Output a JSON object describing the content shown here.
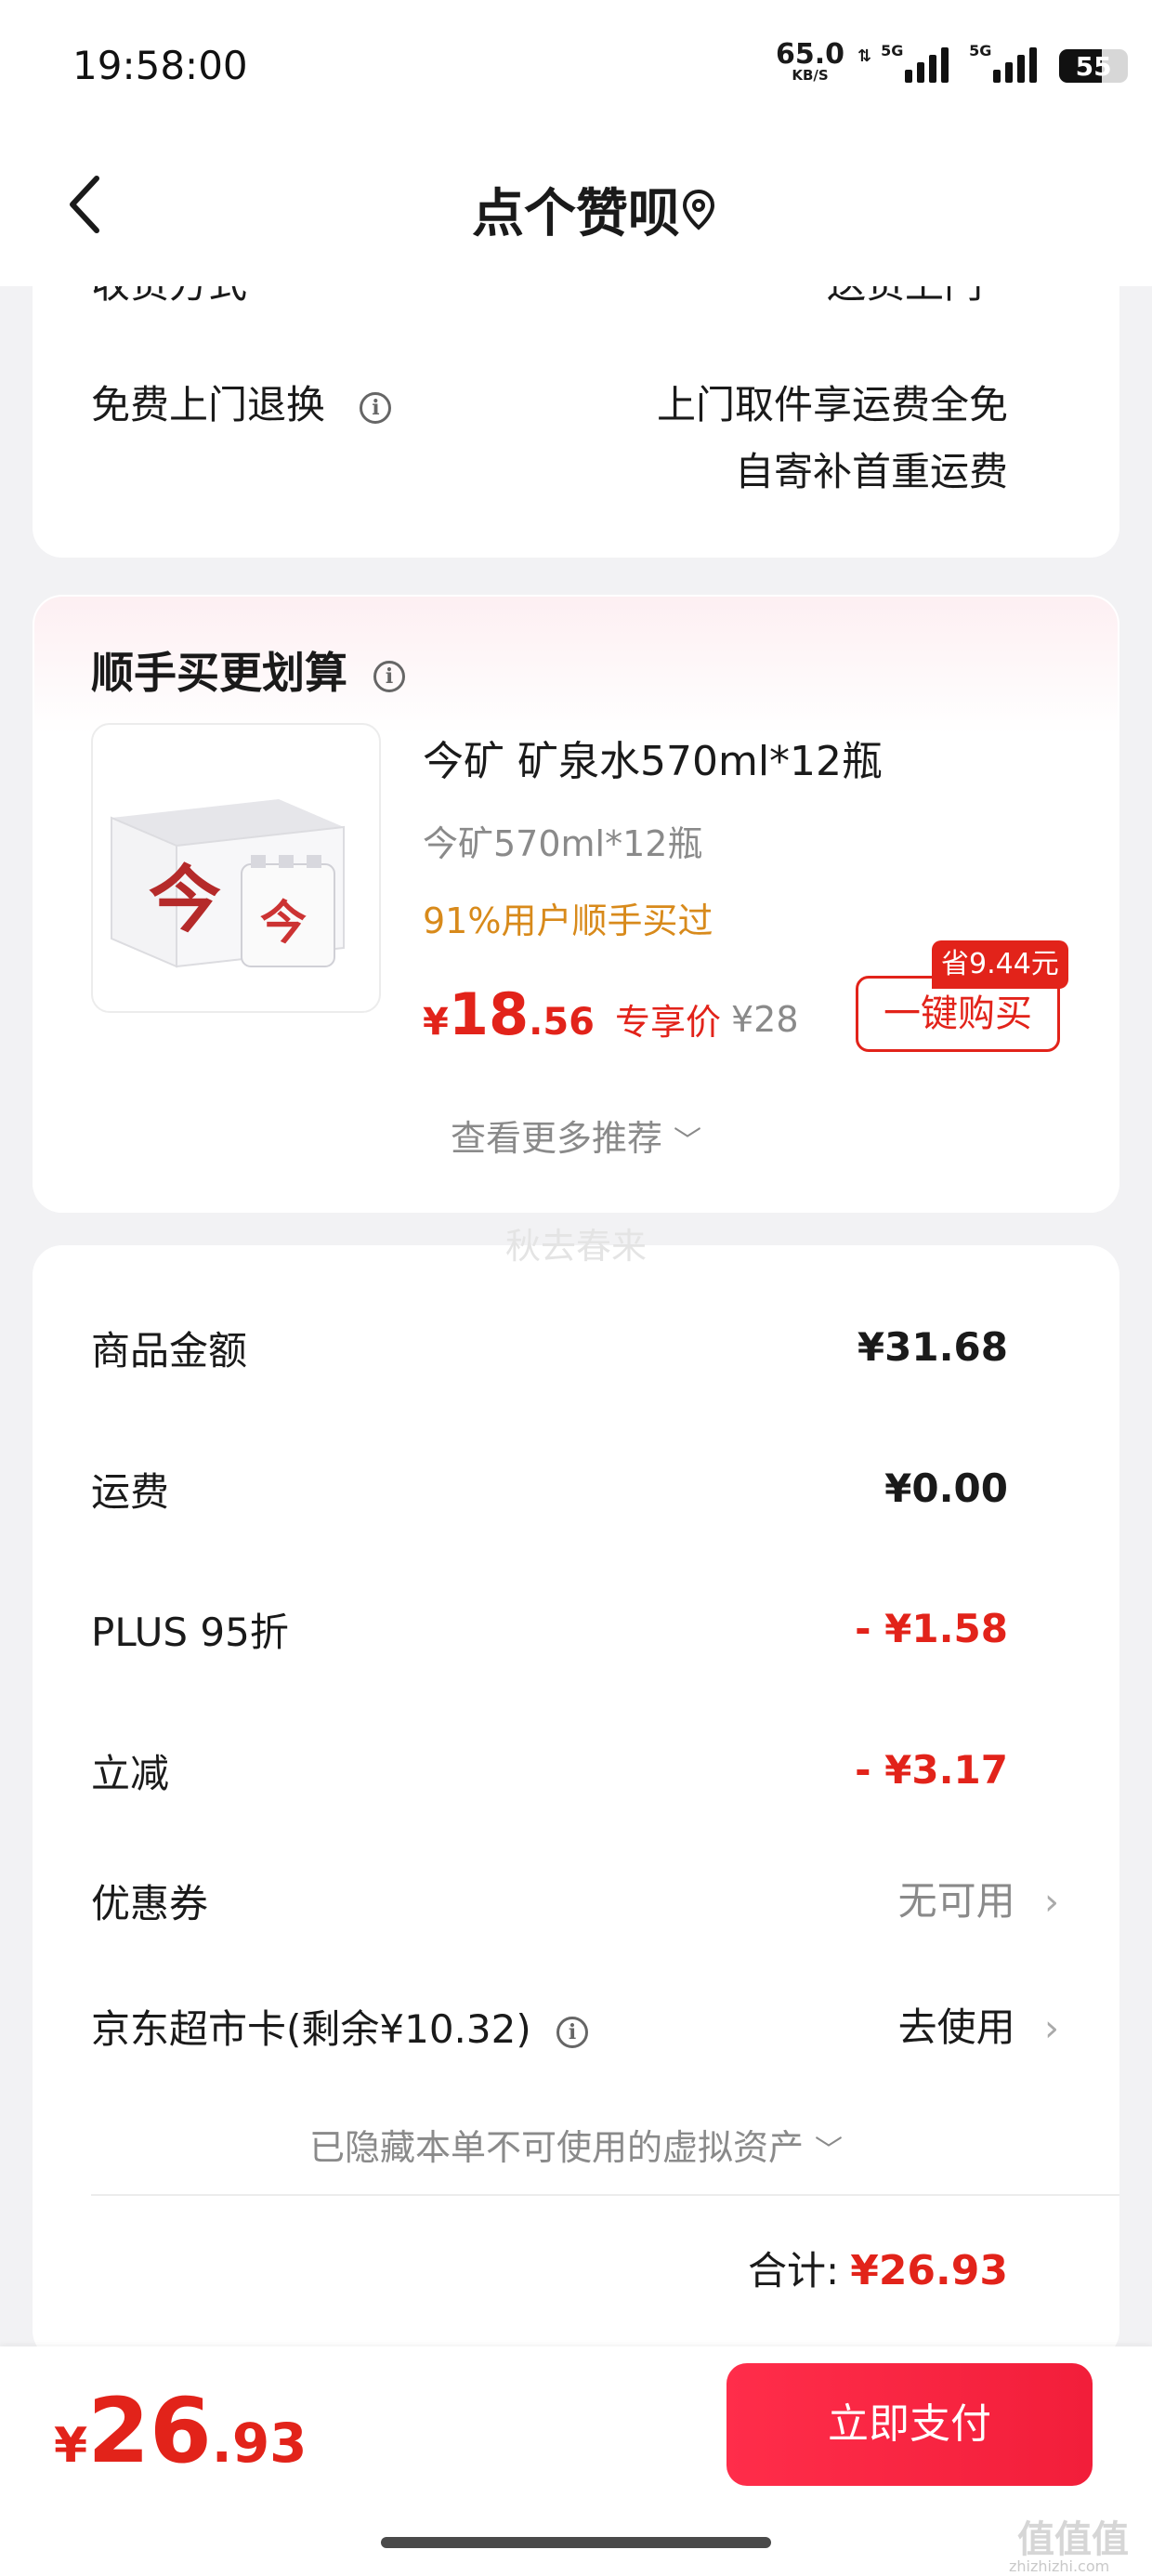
{
  "status_bar": {
    "time": "19:58:00",
    "speed_value": "65.0",
    "speed_unit": "KB/S",
    "signal1_label": "5G",
    "signal2_label": "5G",
    "battery": "55"
  },
  "header": {
    "title": "点个赞呗"
  },
  "shipping": {
    "partial_label": "收货方式",
    "partial_value": "送货上门",
    "return_label": "免费上门退换",
    "return_value_line1": "上门取件享运费全免",
    "return_value_line2": "自寄补首重运费"
  },
  "addon": {
    "title": "顺手买更划算",
    "product_name": "今矿 矿泉水570ml*12瓶",
    "product_spec": "今矿570ml*12瓶",
    "buy_rate": "91%用户顺手买过",
    "price_currency": "¥",
    "price_int": "18",
    "price_dec": ".56",
    "price_tag": "专享价",
    "original_price": "¥28",
    "save_badge": "省9.44元",
    "buy_button": "一键购买",
    "more_recommend": "查看更多推荐"
  },
  "watermark": "秋去春来",
  "summary": {
    "items": [
      {
        "label": "商品金额",
        "value": "¥31.68"
      },
      {
        "label": "运费",
        "value": "¥0.00"
      },
      {
        "label": "PLUS 95折",
        "value": "- ¥1.58"
      },
      {
        "label": "立减",
        "value": "- ¥3.17"
      }
    ],
    "coupon_label": "优惠券",
    "coupon_value": "无可用",
    "card_label": "京东超市卡(剩余¥10.32)",
    "card_value": "去使用",
    "hidden_assets": "已隐藏本单不可使用的虚拟资产",
    "total_label": "合计:",
    "total_value": "¥26.93"
  },
  "footer": {
    "total_currency": "¥",
    "total_int": "26",
    "total_dec": ".93",
    "pay_button": "立即支付"
  },
  "corner": {
    "logo": "值值值",
    "url": "zhizhizhi.com"
  },
  "colors": {
    "accent_red": "#e2231a",
    "pay_button": "#f21e3a",
    "orange_text": "#d88a1b"
  }
}
